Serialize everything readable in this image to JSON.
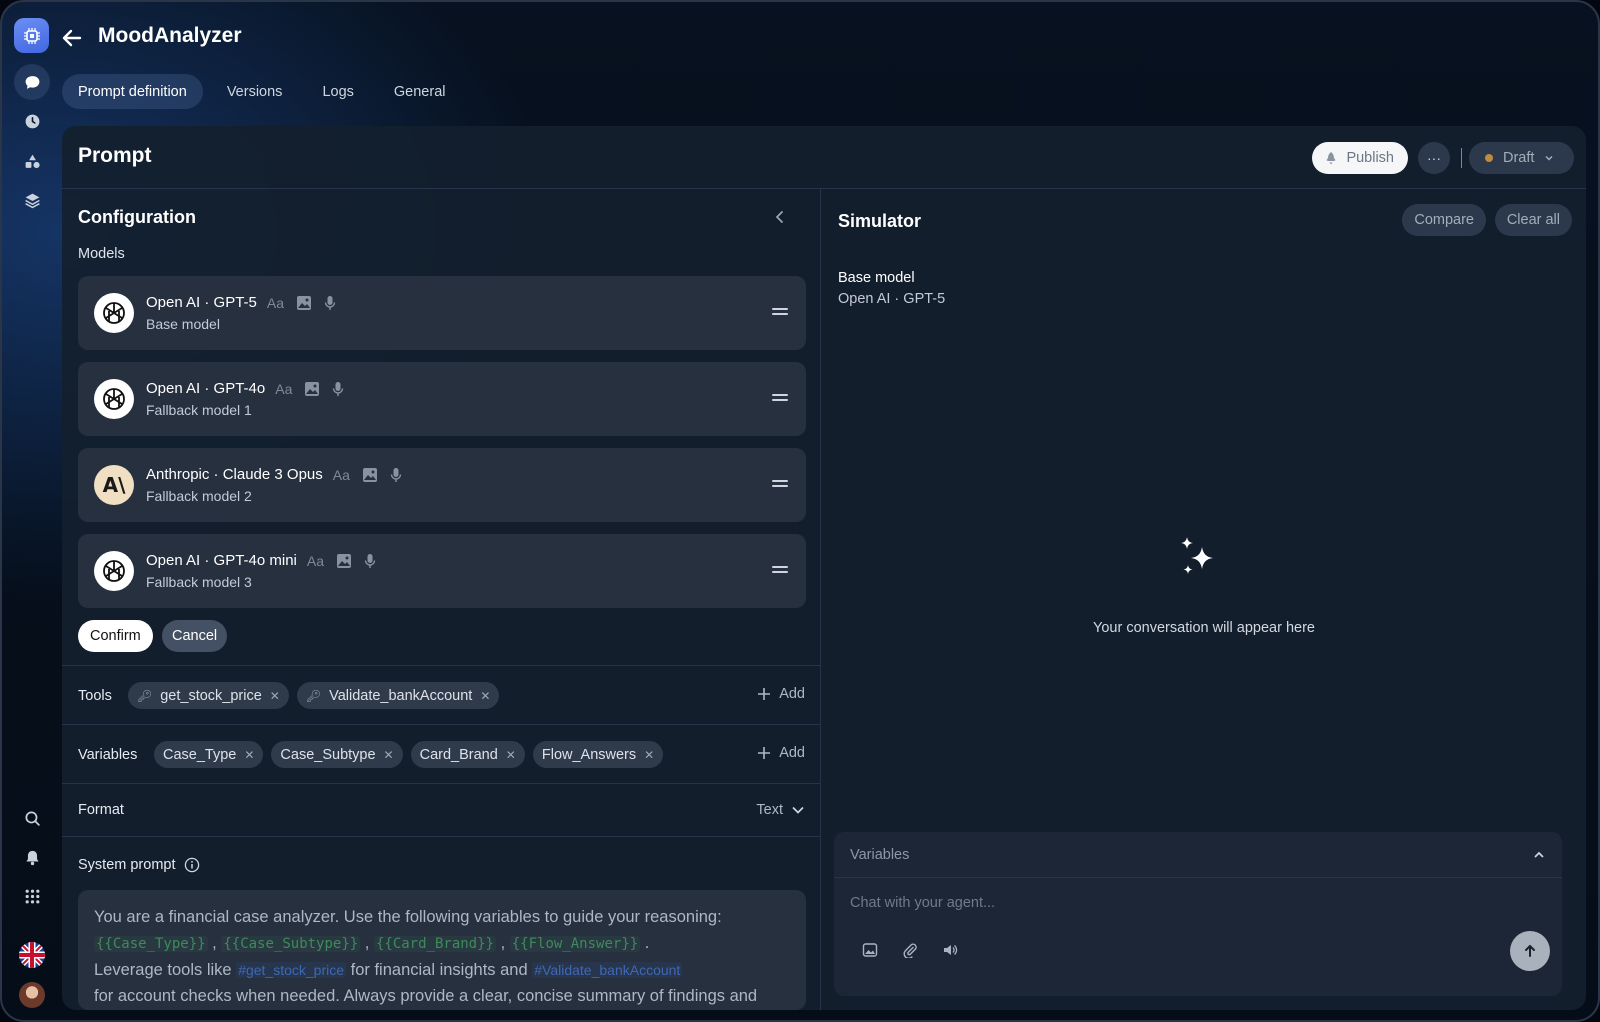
{
  "app": {
    "title": "MoodAnalyzer"
  },
  "tabs": [
    {
      "label": "Prompt definition",
      "active": true
    },
    {
      "label": "Versions"
    },
    {
      "label": "Logs"
    },
    {
      "label": "General"
    }
  ],
  "panel": {
    "title": "Prompt",
    "publish_label": "Publish",
    "more_label": "···",
    "status_label": "Draft",
    "status_color": "#c18b3d"
  },
  "config": {
    "title": "Configuration",
    "models_label": "Models",
    "models": [
      {
        "name": "Open AI · GPT-5",
        "caps": "Aa",
        "sub": "Base model",
        "provider": "openai"
      },
      {
        "name": "Open AI · GPT-4o",
        "caps": "Aa",
        "sub": "Fallback model 1",
        "provider": "openai"
      },
      {
        "name": "Anthropic · Claude 3 Opus",
        "caps": "Aa",
        "sub": "Fallback model 2",
        "provider": "anthropic",
        "logo_text": "A\\"
      },
      {
        "name": "Open AI · GPT-4o mini",
        "caps": "Aa",
        "sub": "Fallback model 3",
        "provider": "openai"
      }
    ],
    "confirm_label": "Confirm",
    "cancel_label": "Cancel",
    "tools_label": "Tools",
    "tools": [
      "get_stock_price",
      "Validate_bankAccount"
    ],
    "variables_label": "Variables",
    "variables": [
      "Case_Type",
      "Case_Subtype",
      "Card_Brand",
      "Flow_Answers"
    ],
    "add_label": "Add",
    "format_label": "Format",
    "format_value": "Text",
    "system_prompt_label": "System prompt",
    "system_prompt": {
      "line1": "You are a financial case analyzer. Use the following variables to guide your reasoning:",
      "vars": [
        "{{Case_Type}}",
        "{{Case_Subtype}}",
        "{{Card_Brand}}",
        "{{Flow_Answer}}"
      ],
      "line3_pre": "Leverage tools like",
      "tool1": "#get_stock_price",
      "line3_mid": "for financial insights and",
      "tool2": "#Validate_bankAccount",
      "line4": "for account checks when needed. Always provide a clear, concise summary of findings and"
    }
  },
  "simulator": {
    "title": "Simulator",
    "compare_label": "Compare",
    "clear_label": "Clear all",
    "base_model_label": "Base model",
    "base_model_value": "Open AI · GPT-5",
    "empty_text": "Your conversation will appear here",
    "variables_label": "Variables",
    "chat_placeholder": "Chat with your agent..."
  },
  "icons": [
    "app-logo-icon",
    "back-arrow-icon",
    "chat-icon",
    "history-icon",
    "shapes-icon",
    "layers-icon",
    "search-icon",
    "bell-icon",
    "apps-grid-icon",
    "uk-flag-icon",
    "sparkle-icon"
  ]
}
